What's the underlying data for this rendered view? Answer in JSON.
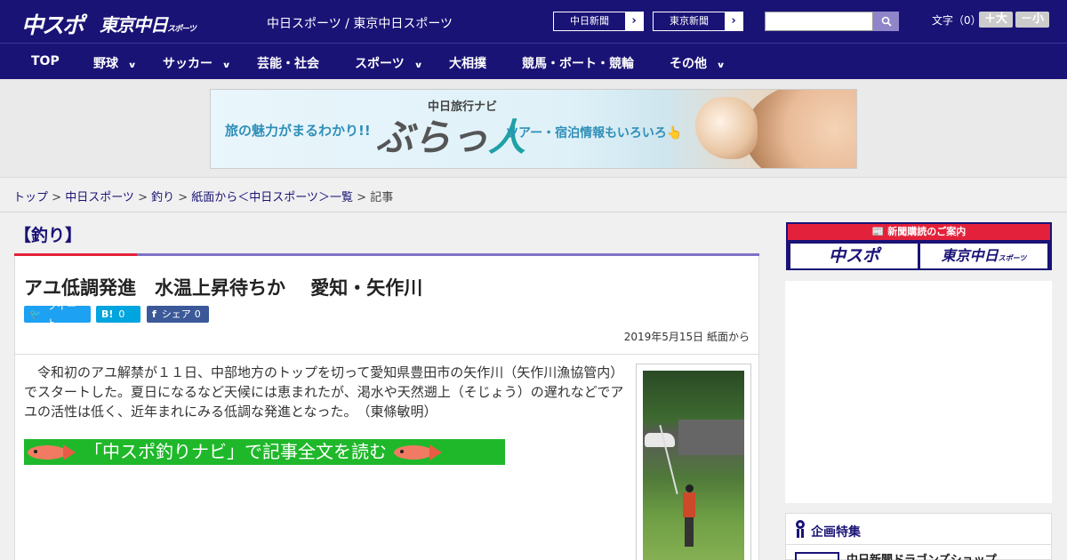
{
  "header": {
    "logo_chusupo": "中スポ",
    "logo_tokyo": "東京中日",
    "logo_tokyo_sub": "スポーツ",
    "site_links": "中日スポーツ / 東京中日スポーツ",
    "news_buttons": [
      {
        "label": "中日新聞",
        "arrow": "›"
      },
      {
        "label": "東京新聞",
        "arrow": "›"
      }
    ],
    "search_placeholder": "",
    "font_size_label": "文字（0）",
    "font_plus": "＋大",
    "font_minus": "－小"
  },
  "nav": {
    "items": [
      {
        "label": "TOP",
        "has_dropdown": false
      },
      {
        "label": "野球",
        "has_dropdown": true
      },
      {
        "label": "サッカー",
        "has_dropdown": true
      },
      {
        "label": "芸能・社会",
        "has_dropdown": false
      },
      {
        "label": "スポーツ",
        "has_dropdown": true
      },
      {
        "label": "大相撲",
        "has_dropdown": false
      },
      {
        "label": "競馬・ボート・競輪",
        "has_dropdown": false
      },
      {
        "label": "その他",
        "has_dropdown": true
      }
    ],
    "chevron": "∨"
  },
  "banner": {
    "lead": "旅の魅力がまるわかり!!",
    "navi": "中日旅行ナビ",
    "logo_pre": "ぶらっ",
    "logo_jin": "人",
    "tail": "ツアー・宿泊情報もいろいろ👆"
  },
  "breadcrumb": {
    "items": [
      "トップ",
      "中日スポーツ",
      "釣り",
      "紙面から＜中日スポーツ＞一覧"
    ],
    "current": "記事",
    "separator": " > "
  },
  "category": "【釣り】",
  "article": {
    "title": "アユ低調発進　水温上昇待ちか　 愛知・矢作川",
    "share": {
      "tweet": {
        "icon": "🐦",
        "label": "ツイート"
      },
      "hatena": {
        "icon": "B!",
        "count": "0"
      },
      "facebook": {
        "icon": "f",
        "label": "シェア",
        "count": "0"
      }
    },
    "date": "2019年5月15日 紙面から",
    "body": "　令和初のアユ解禁が１１日、中部地方のトップを切って愛知県豊田市の矢作川（矢作川漁協管内）でスタートした。夏日になるなど天候には恵まれたが、渇水や天然遡上（そじょう）の遅れなどでアユの活性は低く、近年まれにみる低調な発進となった。　（東條敏明）",
    "navi_link": "「中スポ釣りナビ」で記事全文を読む"
  },
  "sidebar": {
    "ad_header": "📰 新聞購読のご案内",
    "ad_chusupo": "中スポ",
    "ad_tokyo": "東京中日",
    "ad_tokyo_sub": "スポーツ",
    "feature_heading": "企画特集",
    "feature_item": "中日新聞ドラゴンズショップ"
  },
  "colors": {
    "brand": "#1a1376",
    "accent_red": "#e4213a",
    "navi_green": "#1fb82a",
    "tweet": "#1da1f2",
    "hatena": "#00a4de",
    "facebook": "#3b5998"
  }
}
